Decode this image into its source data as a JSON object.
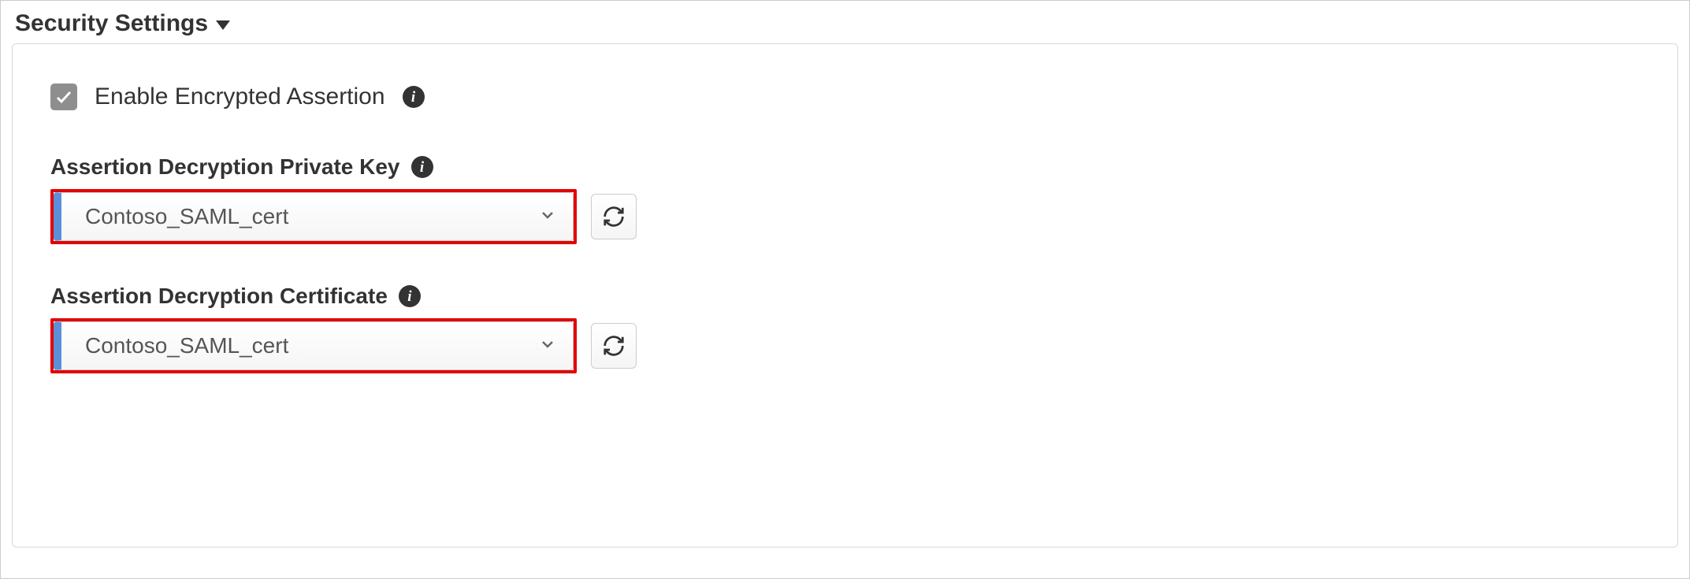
{
  "section": {
    "title": "Security Settings"
  },
  "enableEncrypted": {
    "label": "Enable Encrypted Assertion",
    "checked": true
  },
  "fields": {
    "privateKey": {
      "label": "Assertion Decryption Private Key",
      "value": "Contoso_SAML_cert"
    },
    "certificate": {
      "label": "Assertion Decryption Certificate",
      "value": "Contoso_SAML_cert"
    }
  }
}
